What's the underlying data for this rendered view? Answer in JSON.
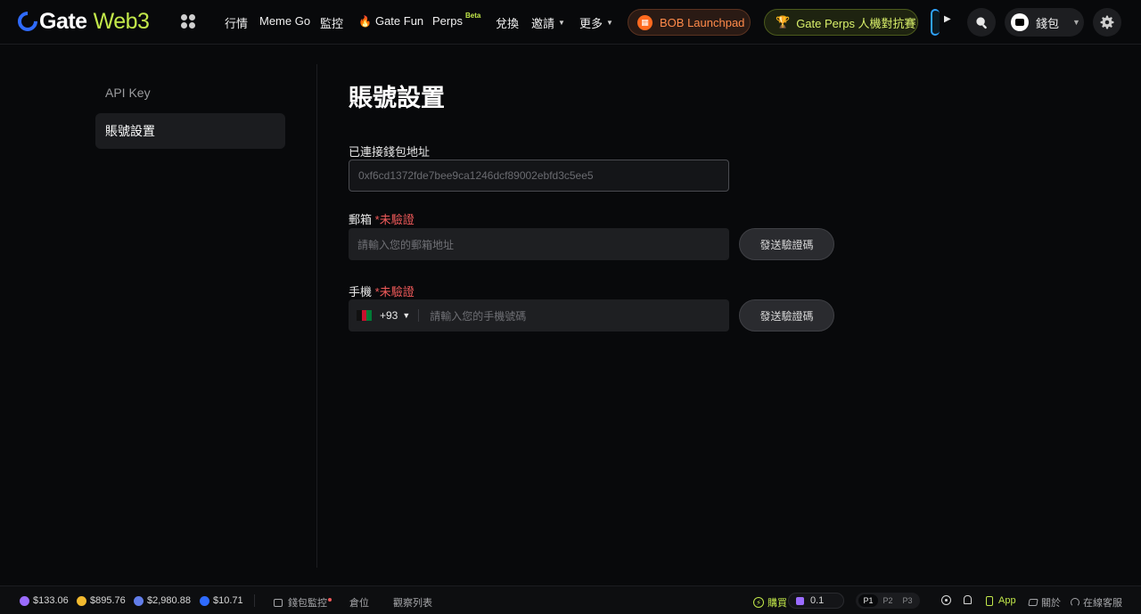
{
  "header": {
    "logo_gate": "Gate",
    "logo_web3": "Web3",
    "nav": {
      "market": "行情",
      "meme_go": "Meme Go",
      "monitor": "監控",
      "gate_fun": "Gate Fun",
      "perps": "Perps",
      "perps_badge": "Beta",
      "swap": "兌換",
      "invite": "邀請",
      "more": "更多"
    },
    "bob_launchpad": "BOB Launchpad",
    "perps_contest": "Gate Perps 人機對抗賽",
    "wallet": "錢包"
  },
  "sidebar": {
    "items": [
      {
        "label": "API Key"
      },
      {
        "label": "賬號設置"
      }
    ]
  },
  "main": {
    "title": "賬號設置",
    "wallet_address": {
      "label": "已連接錢包地址",
      "value": "0xf6cd1372fde7bee9ca1246dcf89002ebfd3c5ee5"
    },
    "email": {
      "label": "郵箱",
      "status": "*未驗證",
      "placeholder": "請輸入您的郵箱地址",
      "send_button": "發送驗證碼"
    },
    "phone": {
      "label": "手機",
      "status": "*未驗證",
      "country_code": "+93",
      "placeholder": "請輸入您的手機號碼",
      "send_button": "發送驗證碼"
    }
  },
  "footer": {
    "prices": [
      {
        "symbol": "SOL",
        "value": "$133.06",
        "color": "#9b6cff"
      },
      {
        "symbol": "BNB",
        "value": "$895.76",
        "color": "#f3ba2f"
      },
      {
        "symbol": "ETH",
        "value": "$2,980.88",
        "color": "#627eea"
      },
      {
        "symbol": "GT",
        "value": "$10.71",
        "color": "#2f6bff"
      }
    ],
    "wallet_monitor": "錢包監控",
    "positions": "倉位",
    "watchlist": "觀察列表",
    "buy": "購買",
    "buy_amount": "0.1",
    "presets": [
      "P1",
      "P2",
      "P3"
    ],
    "app": "App",
    "about": "關於",
    "support": "在線客服"
  },
  "colors": {
    "accent": "#c2e84a",
    "brand_blue": "#2f6bff",
    "warning_red": "#f05a5a"
  }
}
